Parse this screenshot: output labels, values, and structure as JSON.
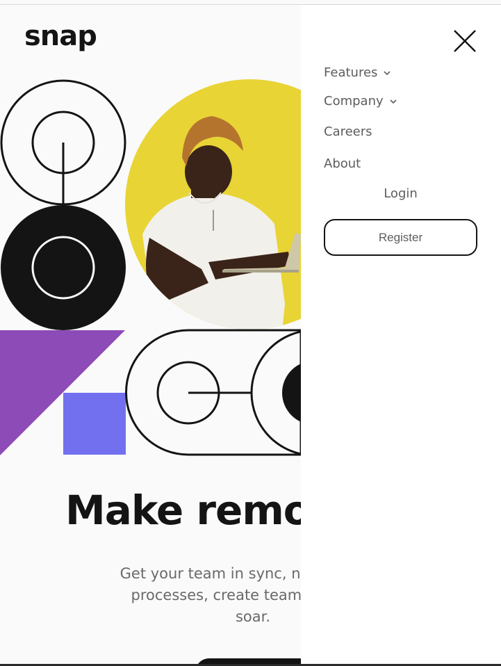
{
  "brand": {
    "logo_text": "snap"
  },
  "hero": {
    "headline": "Make remot",
    "lead_lines": [
      "Get your team in sync, no matter yo",
      "processes, create team rituals, ar",
      "soar."
    ]
  },
  "menu": {
    "items": [
      {
        "label": "Features",
        "has_dropdown": true
      },
      {
        "label": "Company",
        "has_dropdown": true
      },
      {
        "label": "Careers",
        "has_dropdown": false
      },
      {
        "label": "About",
        "has_dropdown": false
      }
    ],
    "login_label": "Login",
    "register_label": "Register",
    "close_icon": "close-icon"
  },
  "colors": {
    "ink": "#141414",
    "muted_text": "#5d5d5d",
    "yellow": "#e8d435",
    "purple": "#8d4bb8",
    "violet": "#7270ef"
  }
}
